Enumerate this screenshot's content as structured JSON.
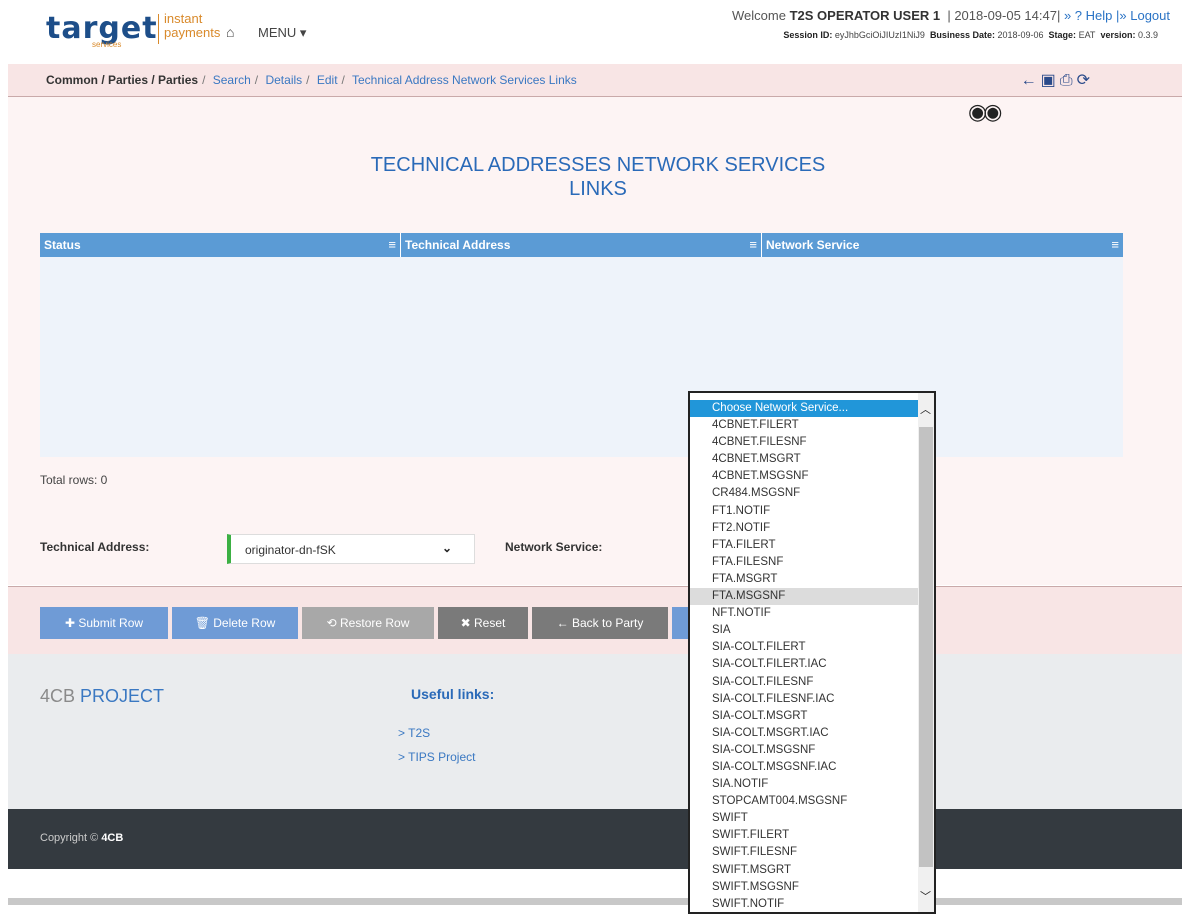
{
  "header": {
    "logo_word": "target",
    "logo_sub": "services",
    "logo_line1": "instant",
    "logo_line2": "payments",
    "home_icon": "home-icon",
    "menu_label": "MENU",
    "welcome_prefix": "Welcome",
    "user": "T2S OPERATOR USER 1",
    "datetime": "| 2018-09-05 14:47|",
    "help": "» ? Help",
    "logout": "|» Logout",
    "session_label": "Session ID:",
    "session_id": "eyJhbGciOiJIUzI1NiJ9",
    "business_date_label": "Business Date:",
    "business_date": "2018-09-06",
    "stage_label": "Stage:",
    "stage": "EAT",
    "version_label": "version:",
    "version": "0.3.9"
  },
  "breadcrumb": {
    "root": "Common / Parties / Parties",
    "items": [
      "Search",
      "Details",
      "Edit",
      "Technical Address Network Services Links"
    ]
  },
  "page": {
    "title_line1": "TECHNICAL ADDRESSES NETWORK SERVICES",
    "title_line2": "LINKS",
    "columns": [
      "Status",
      "Technical Address",
      "Network Service"
    ],
    "total_rows": "Total rows: 0",
    "technical_address_label": "Technical Address:",
    "technical_address_value": "originator-dn-fSK",
    "network_service_label": "Network Service:"
  },
  "buttons": {
    "submit": "✚ Submit Row",
    "delete": "🗑 Delete Row",
    "restore": "⟲ Restore Row",
    "reset": "✖ Reset",
    "back": "← Back to Party"
  },
  "footer": {
    "project_a": "4CB",
    "project_b": "PROJECT",
    "useful": "Useful links:",
    "links": [
      "> T2S",
      "> TIPS Project"
    ],
    "copyright_prefix": "Copyright ©",
    "copyright_owner": "4CB"
  },
  "dropdown": {
    "options": [
      "Choose Network Service...",
      "4CBNET.FILERT",
      "4CBNET.FILESNF",
      "4CBNET.MSGRT",
      "4CBNET.MSGSNF",
      "CR484.MSGSNF",
      "FT1.NOTIF",
      "FT2.NOTIF",
      "FTA.FILERT",
      "FTA.FILESNF",
      "FTA.MSGRT",
      "FTA.MSGSNF",
      "NFT.NOTIF",
      "SIA",
      "SIA-COLT.FILERT",
      "SIA-COLT.FILERT.IAC",
      "SIA-COLT.FILESNF",
      "SIA-COLT.FILESNF.IAC",
      "SIA-COLT.MSGRT",
      "SIA-COLT.MSGRT.IAC",
      "SIA-COLT.MSGSNF",
      "SIA-COLT.MSGSNF.IAC",
      "SIA.NOTIF",
      "STOPCAMT004.MSGSNF",
      "SWIFT",
      "SWIFT.FILERT",
      "SWIFT.FILESNF",
      "SWIFT.MSGRT",
      "SWIFT.MSGSNF",
      "SWIFT.NOTIF"
    ],
    "selected": "Choose Network Service...",
    "hovered": "FTA.MSGSNF"
  },
  "colors": {
    "accent": "#2a6ab8",
    "grid_header": "#5b9bd5",
    "select_border": "#3cb043"
  }
}
